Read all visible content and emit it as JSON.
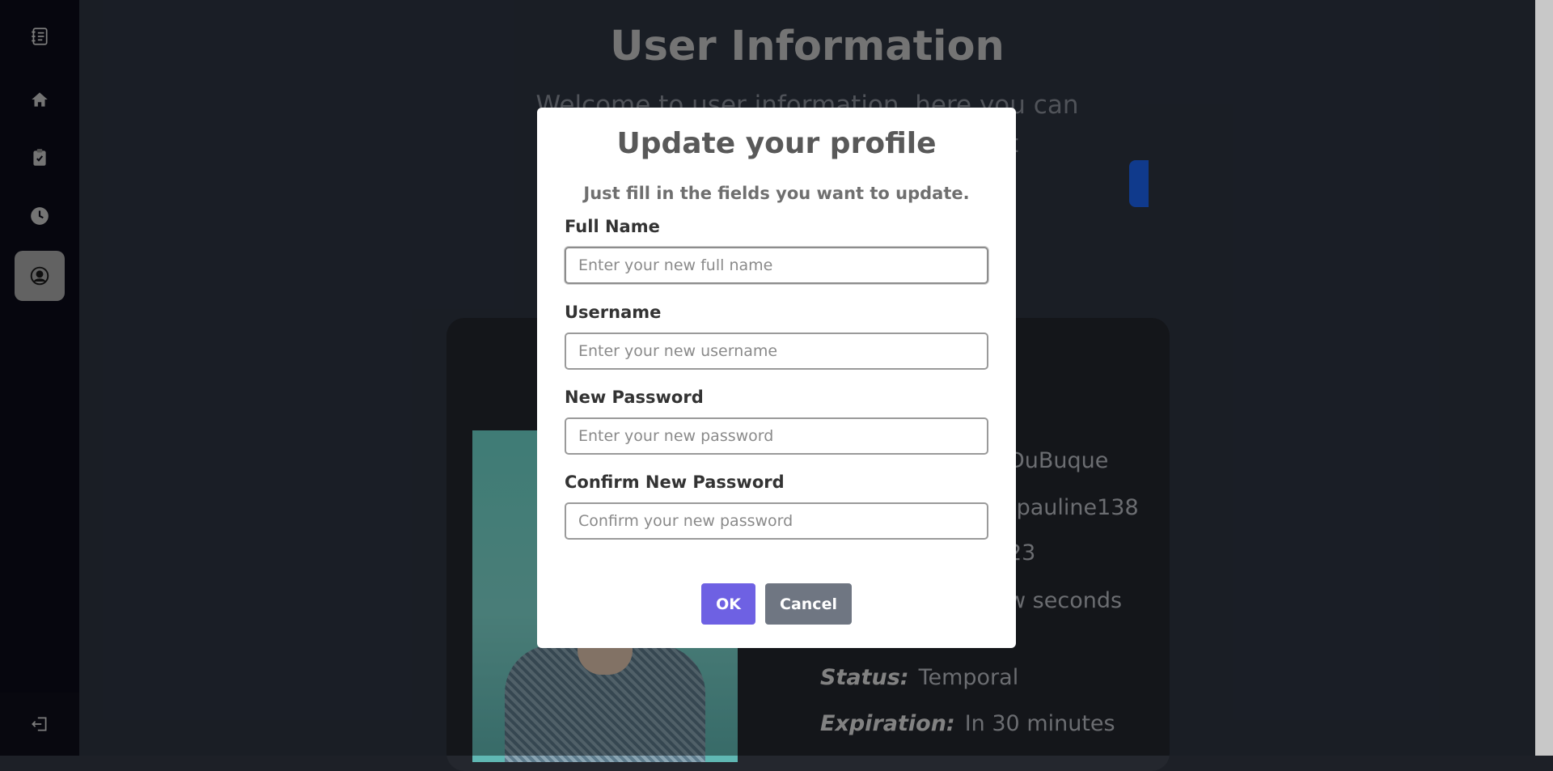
{
  "page": {
    "title": "User Information",
    "subtitle": "Welcome to user information, here you can change it if you want to change it"
  },
  "profile": {
    "name_value": "DuBuque",
    "username_value": "tpauline138",
    "date_value": "23",
    "last_seen_value": "w seconds",
    "status_label": "Status:",
    "status_value": "Temporal",
    "expiration_label": "Expiration:",
    "expiration_value": "In 30 minutes"
  },
  "modal": {
    "title": "Update your profile",
    "subtitle": "Just fill in the fields you want to update.",
    "fields": [
      {
        "label": "Full Name",
        "placeholder": "Enter your new full name"
      },
      {
        "label": "Username",
        "placeholder": "Enter your new username"
      },
      {
        "label": "New Password",
        "placeholder": "Enter your new password"
      },
      {
        "label": "Confirm New Password",
        "placeholder": "Confirm your new password"
      }
    ],
    "ok_label": "OK",
    "cancel_label": "Cancel"
  },
  "sidebar": {
    "items": [
      {
        "icon": "notebook-icon"
      },
      {
        "icon": "home-icon"
      },
      {
        "icon": "clipboard-check-icon"
      },
      {
        "icon": "clock-icon"
      },
      {
        "icon": "user-circle-icon",
        "active": true
      }
    ],
    "logout_icon": "logout-icon"
  },
  "colors": {
    "accent": "#6e61e3",
    "cancel": "#6f7682",
    "sidebar_bg": "#0c0c19",
    "main_bg": "#2d3441",
    "blue": "#1c64f2"
  }
}
